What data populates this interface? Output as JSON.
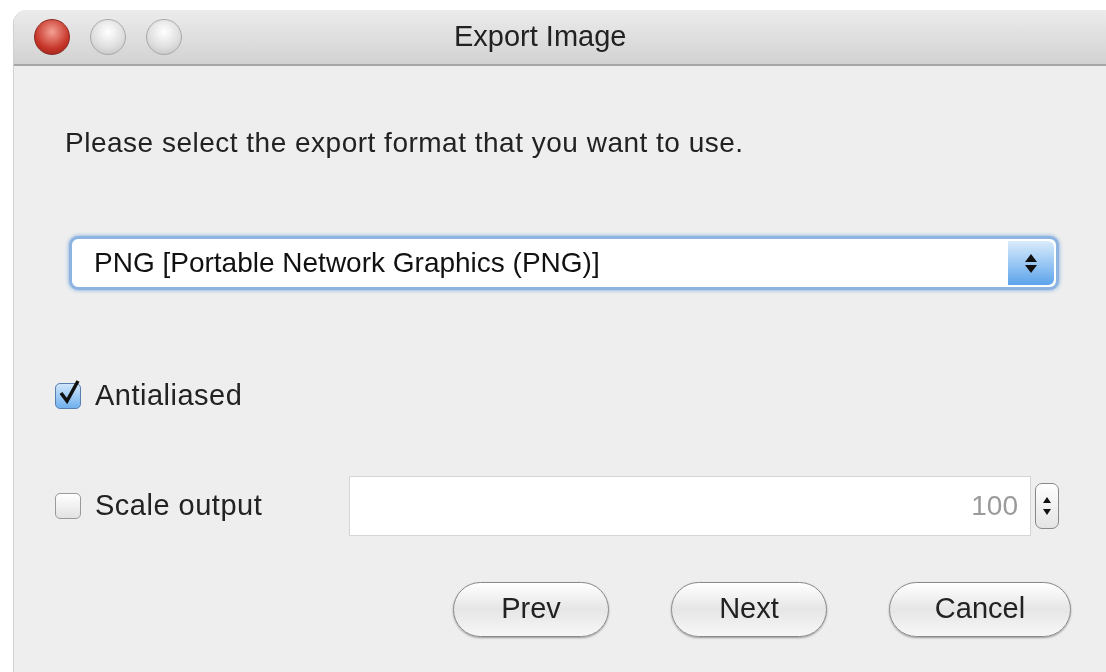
{
  "window": {
    "title": "Export Image"
  },
  "prompt": "Please select the export format that you want to use.",
  "format_select": {
    "value": "PNG [Portable Network Graphics (PNG)]"
  },
  "options": [
    {
      "kind": "checkbox",
      "label": "Antialiased",
      "checked": true
    },
    {
      "kind": "checkbox_with_spinner",
      "label": "Scale output",
      "checked": false,
      "value": "100",
      "disabled": true
    }
  ],
  "buttons": [
    "Prev",
    "Next",
    "Cancel"
  ]
}
